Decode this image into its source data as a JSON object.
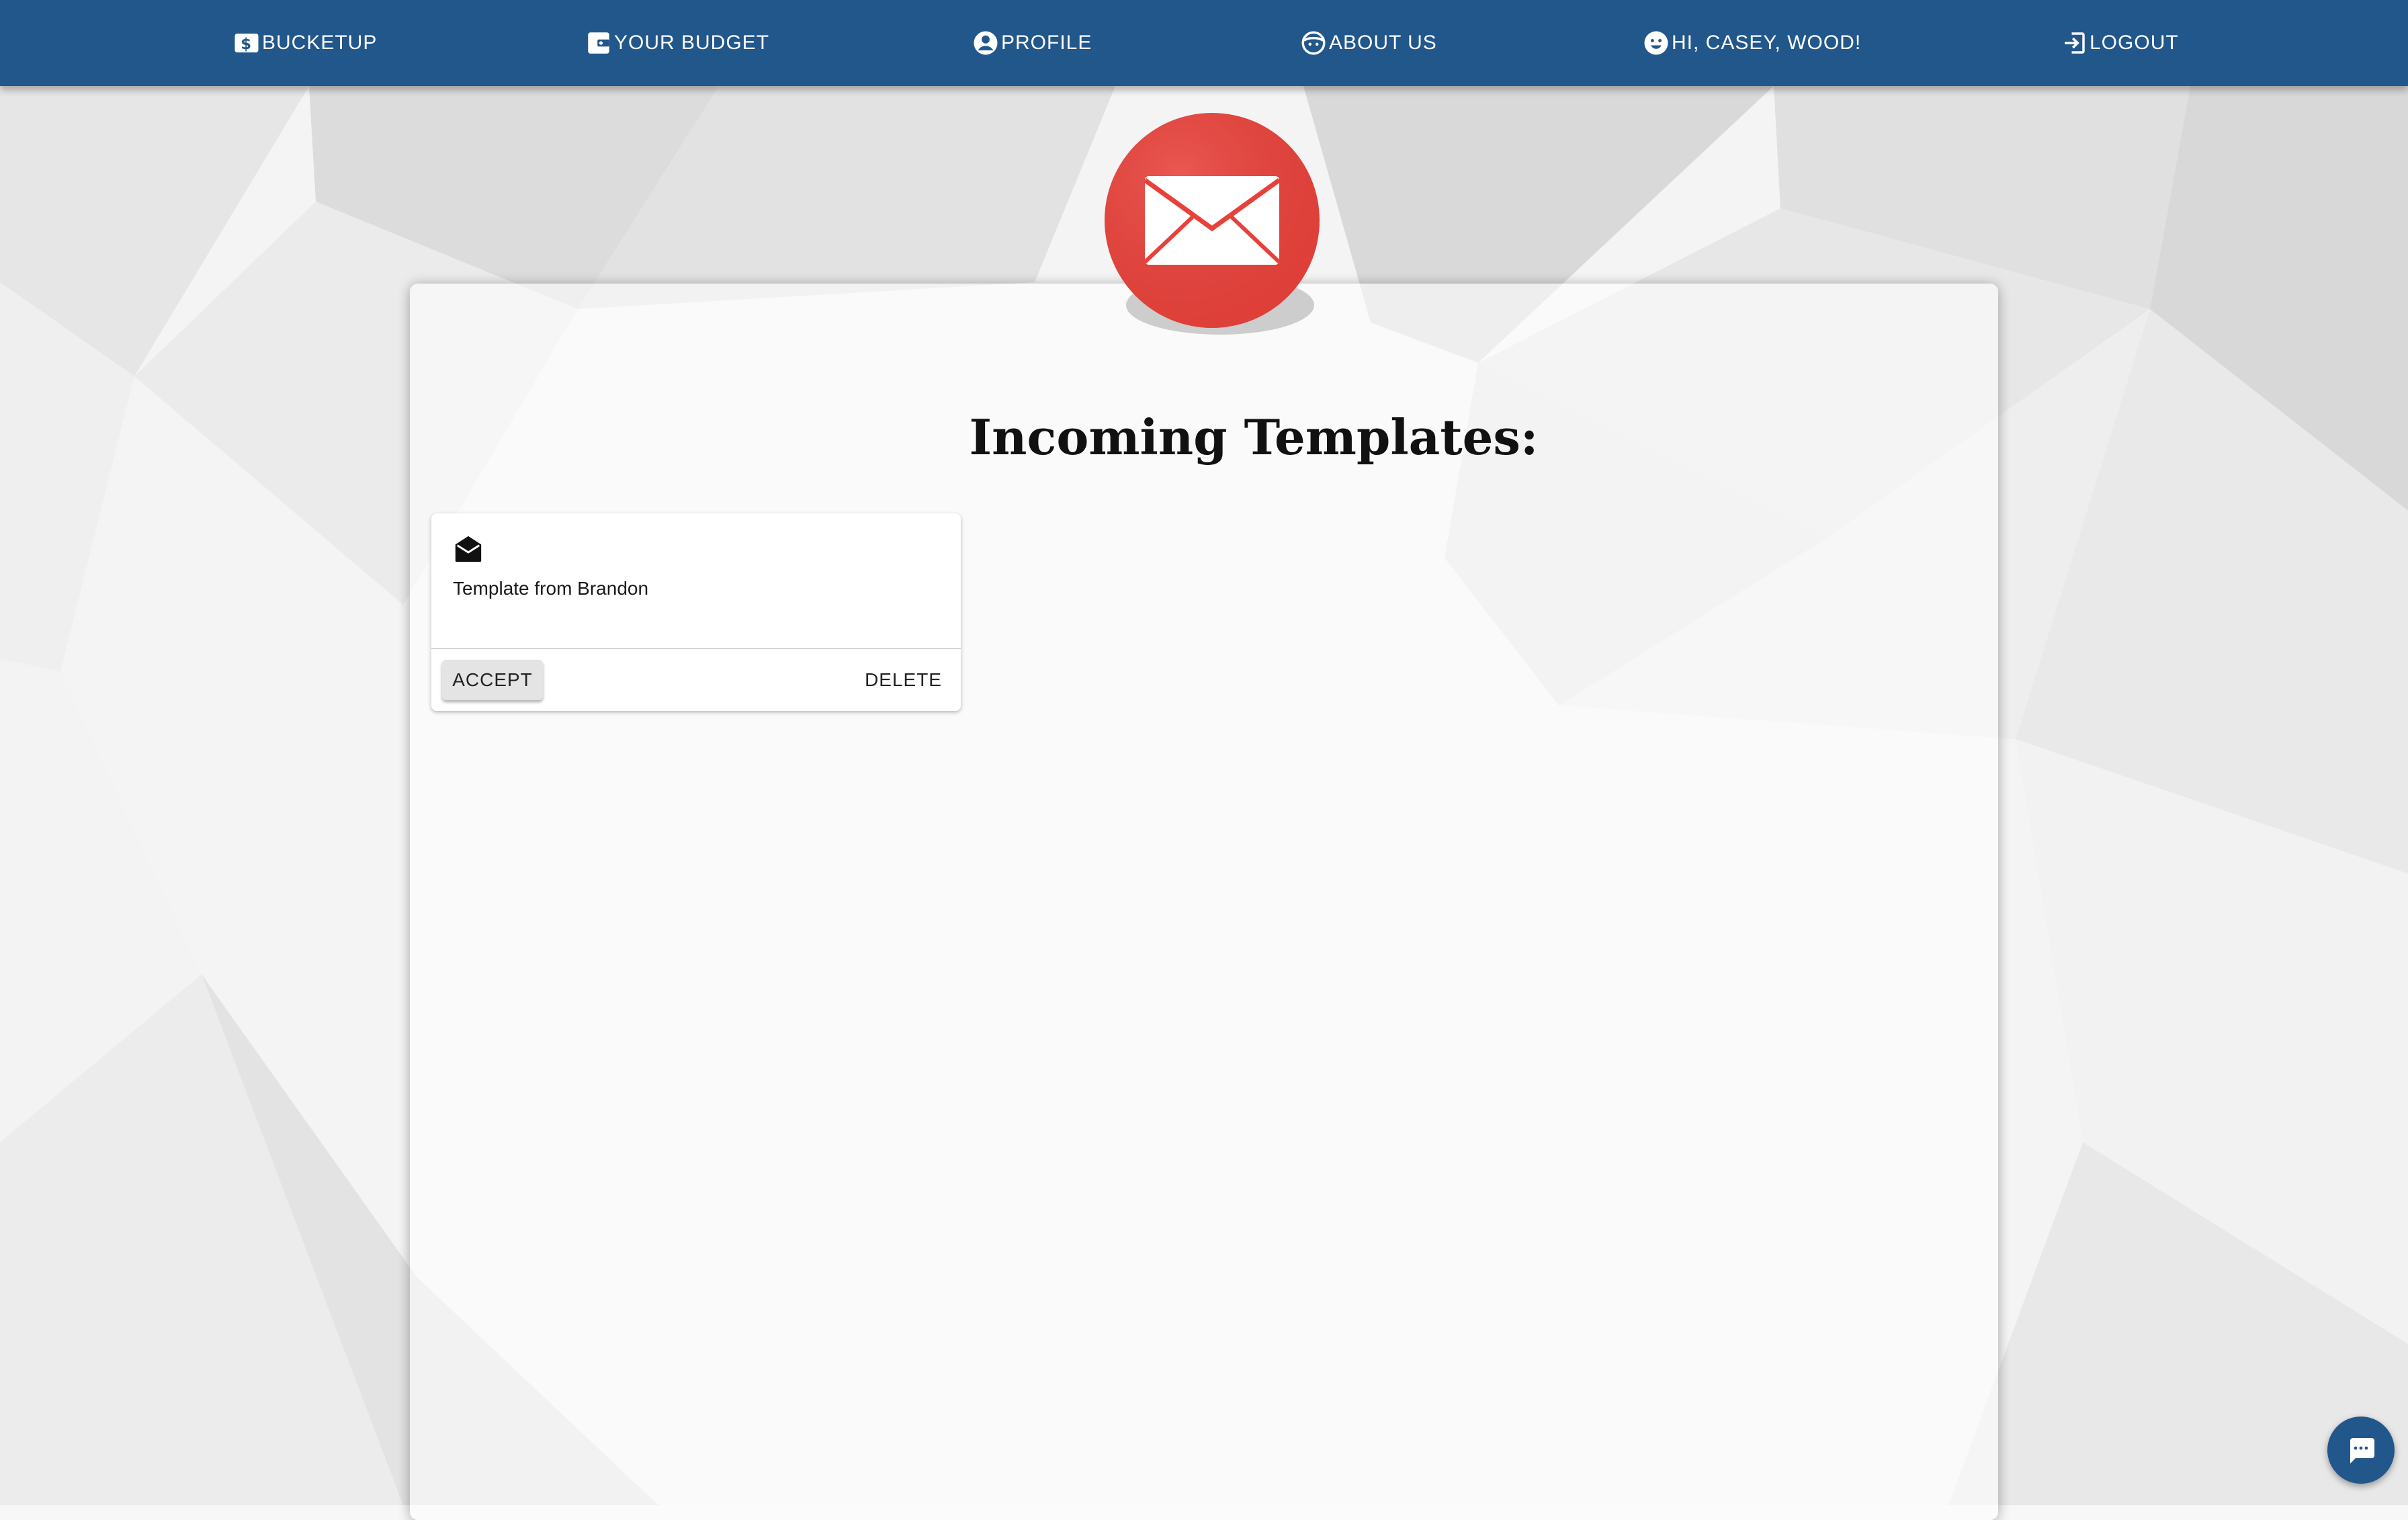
{
  "nav": {
    "brand": {
      "label": "BUCKETUP",
      "icon": "dollar-bill-icon"
    },
    "budget": {
      "label": "YOUR BUDGET",
      "icon": "wallet-icon"
    },
    "profile": {
      "label": "PROFILE",
      "icon": "account-circle-icon"
    },
    "about": {
      "label": "ABOUT US",
      "icon": "face-icon"
    },
    "greeting": {
      "label": "HI, CASEY, WOOD!",
      "icon": "smiley-icon"
    },
    "logout": {
      "label": "LOGOUT",
      "icon": "logout-icon"
    }
  },
  "main": {
    "badge_icon": "mail-envelope-icon",
    "heading": "Incoming Templates:",
    "templates": [
      {
        "icon": "open-mail-icon",
        "title": "Template from Brandon",
        "accept_label": "ACCEPT",
        "delete_label": "DELETE"
      }
    ]
  },
  "chat": {
    "icon": "chat-bubble-icon"
  },
  "colors": {
    "navbar": "#22578b",
    "badge_red": "#e8413a",
    "accept_button": "#e4e4e4"
  }
}
